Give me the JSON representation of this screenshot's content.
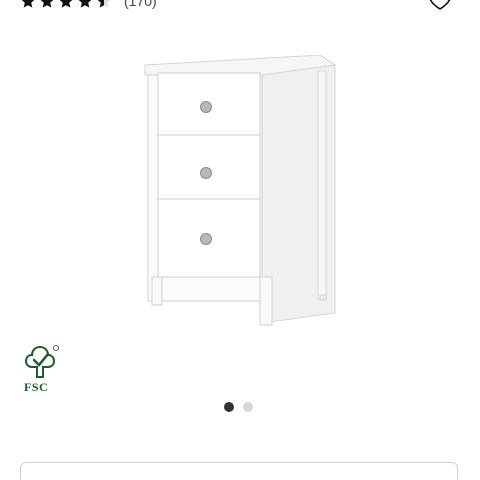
{
  "rating": {
    "stars": 4.5,
    "count_text": "(170)"
  },
  "wishlist": {
    "icon": "heart-icon"
  },
  "product": {
    "image": "white-3-drawer-chest"
  },
  "badge": {
    "text": "FSC"
  },
  "carousel": {
    "total": 2,
    "active_index": 0
  },
  "colors": {
    "dot_active": "#333333",
    "dot_inactive": "#d6d6d6",
    "fsc_green": "#1d5c2e"
  }
}
